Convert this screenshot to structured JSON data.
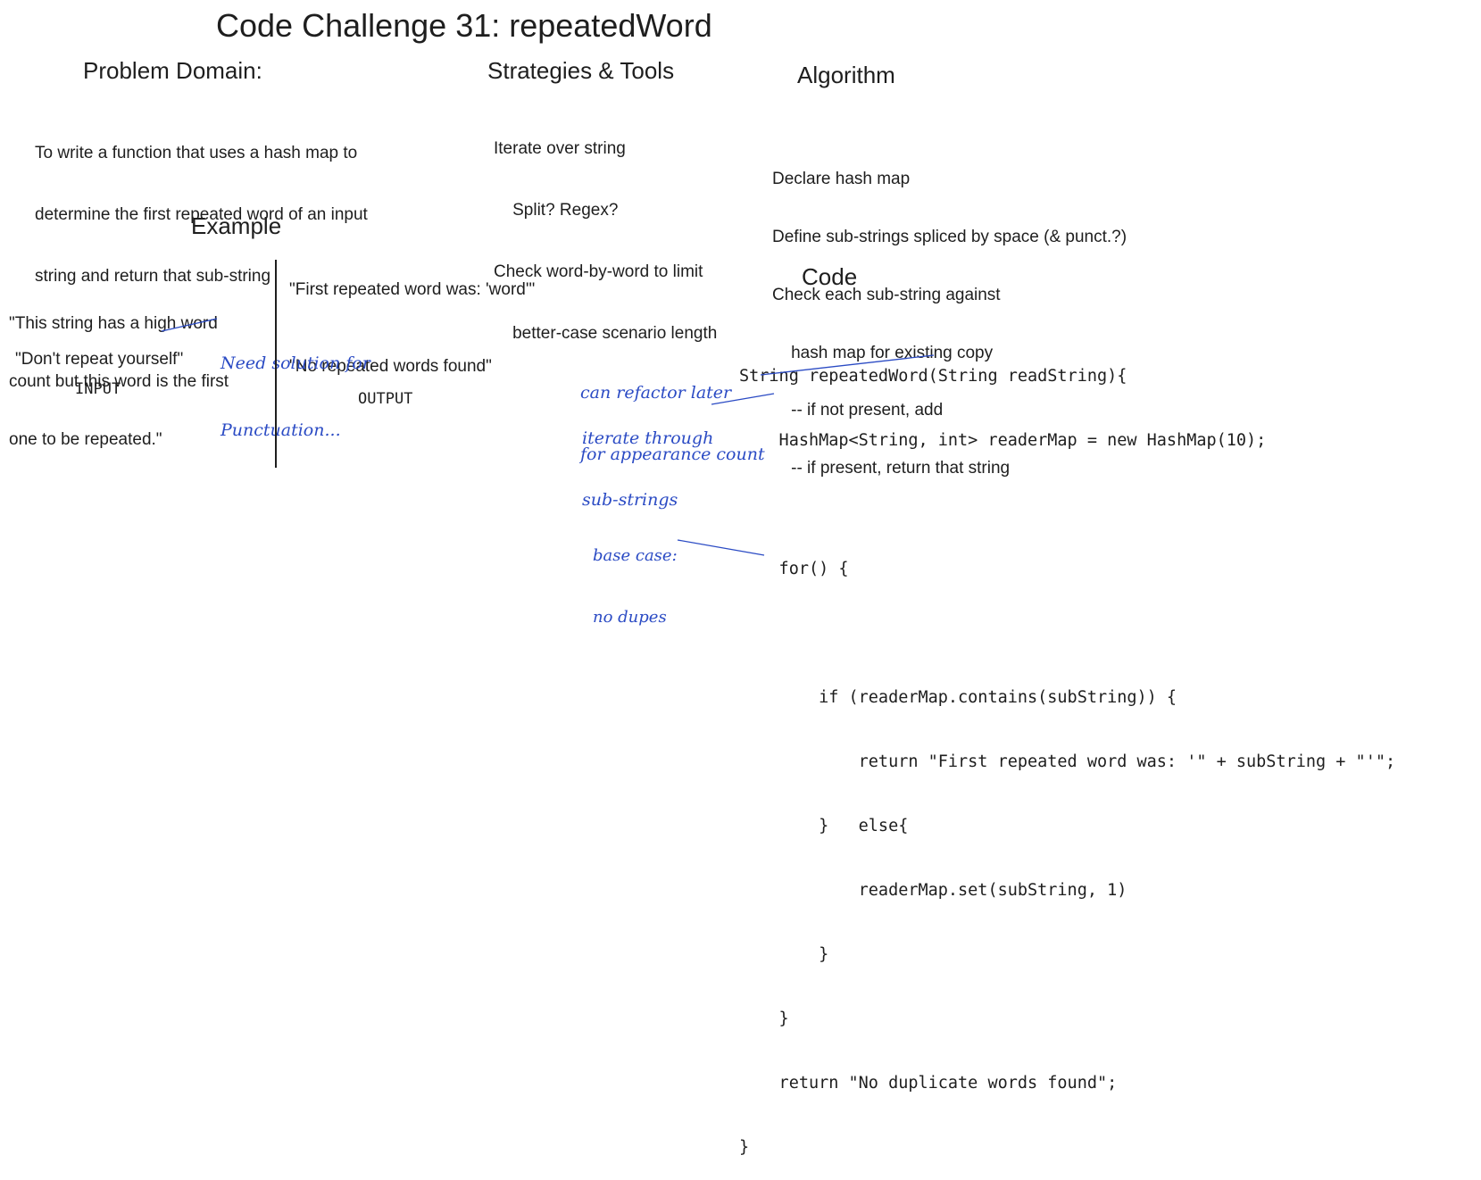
{
  "title": "Code Challenge 31: repeatedWord",
  "problem_domain": {
    "heading": "Problem Domain:",
    "lines": [
      "To write a function that uses a hash map to",
      "determine the first repeated word of an input",
      "string and return that sub-string"
    ]
  },
  "strategies": {
    "heading": "Strategies & Tools",
    "lines": [
      "Iterate over string",
      "    Split? Regex?",
      "Check word-by-word to limit",
      "    better-case scenario length"
    ]
  },
  "algorithm": {
    "heading": "Algorithm",
    "lines": [
      "Declare hash map",
      "Define sub-strings spliced by space (& punct.?)",
      "Check each sub-string against",
      "    hash map for existing copy",
      "    -- if not present, add",
      "    -- if present, return that string"
    ]
  },
  "example": {
    "heading": "Example",
    "input_1": [
      "\"This string has a high word",
      "count but this word is the first",
      "one to be repeated.\""
    ],
    "input_2": "\"Don't repeat yourself\"",
    "input_label": "INPUT",
    "output_1": "\"First repeated word was: 'word'\"",
    "output_2": "\"No repeated words found\"",
    "output_label": "OUTPUT"
  },
  "code": {
    "heading": "Code",
    "lines": [
      "String repeatedWord(String readString){",
      "    HashMap<String, int> readerMap = new HashMap(10);",
      "",
      "    for() {",
      "",
      "        if (readerMap.contains(subString)) {",
      "            return \"First repeated word was: '\" + subString + \"'\";",
      "        }   else{",
      "            readerMap.set(subString, 1)",
      "        }",
      "    }",
      "    return \"No duplicate words found\";",
      "}"
    ]
  },
  "annotations": {
    "punctuation": [
      "Need solution for",
      "Punctuation..."
    ],
    "refactor": [
      "can refactor later",
      "for appearance count"
    ],
    "iterate": [
      "iterate through",
      "sub-strings"
    ],
    "base_case": [
      "base case:",
      "no dupes"
    ]
  },
  "colors": {
    "ink": "#1e1e1e",
    "annotation": "#2b4bc4"
  }
}
